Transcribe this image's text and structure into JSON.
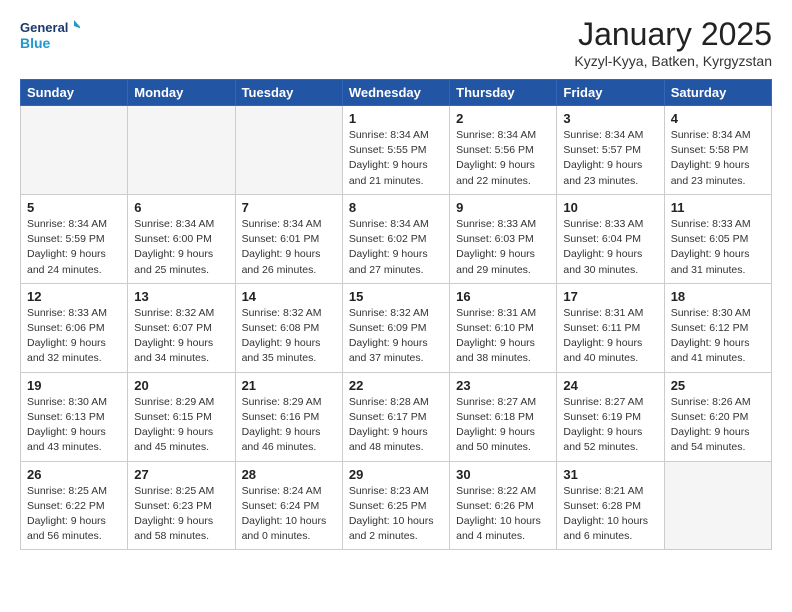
{
  "header": {
    "logo_line1": "General",
    "logo_line2": "Blue",
    "month_title": "January 2025",
    "location": "Kyzyl-Kyya, Batken, Kyrgyzstan"
  },
  "days_of_week": [
    "Sunday",
    "Monday",
    "Tuesday",
    "Wednesday",
    "Thursday",
    "Friday",
    "Saturday"
  ],
  "weeks": [
    [
      {
        "day": "",
        "empty": true
      },
      {
        "day": "",
        "empty": true
      },
      {
        "day": "",
        "empty": true
      },
      {
        "day": "1",
        "sunrise": "8:34 AM",
        "sunset": "5:55 PM",
        "daylight": "9 hours and 21 minutes."
      },
      {
        "day": "2",
        "sunrise": "8:34 AM",
        "sunset": "5:56 PM",
        "daylight": "9 hours and 22 minutes."
      },
      {
        "day": "3",
        "sunrise": "8:34 AM",
        "sunset": "5:57 PM",
        "daylight": "9 hours and 23 minutes."
      },
      {
        "day": "4",
        "sunrise": "8:34 AM",
        "sunset": "5:58 PM",
        "daylight": "9 hours and 23 minutes."
      }
    ],
    [
      {
        "day": "5",
        "sunrise": "8:34 AM",
        "sunset": "5:59 PM",
        "daylight": "9 hours and 24 minutes."
      },
      {
        "day": "6",
        "sunrise": "8:34 AM",
        "sunset": "6:00 PM",
        "daylight": "9 hours and 25 minutes."
      },
      {
        "day": "7",
        "sunrise": "8:34 AM",
        "sunset": "6:01 PM",
        "daylight": "9 hours and 26 minutes."
      },
      {
        "day": "8",
        "sunrise": "8:34 AM",
        "sunset": "6:02 PM",
        "daylight": "9 hours and 27 minutes."
      },
      {
        "day": "9",
        "sunrise": "8:33 AM",
        "sunset": "6:03 PM",
        "daylight": "9 hours and 29 minutes."
      },
      {
        "day": "10",
        "sunrise": "8:33 AM",
        "sunset": "6:04 PM",
        "daylight": "9 hours and 30 minutes."
      },
      {
        "day": "11",
        "sunrise": "8:33 AM",
        "sunset": "6:05 PM",
        "daylight": "9 hours and 31 minutes."
      }
    ],
    [
      {
        "day": "12",
        "sunrise": "8:33 AM",
        "sunset": "6:06 PM",
        "daylight": "9 hours and 32 minutes."
      },
      {
        "day": "13",
        "sunrise": "8:32 AM",
        "sunset": "6:07 PM",
        "daylight": "9 hours and 34 minutes."
      },
      {
        "day": "14",
        "sunrise": "8:32 AM",
        "sunset": "6:08 PM",
        "daylight": "9 hours and 35 minutes."
      },
      {
        "day": "15",
        "sunrise": "8:32 AM",
        "sunset": "6:09 PM",
        "daylight": "9 hours and 37 minutes."
      },
      {
        "day": "16",
        "sunrise": "8:31 AM",
        "sunset": "6:10 PM",
        "daylight": "9 hours and 38 minutes."
      },
      {
        "day": "17",
        "sunrise": "8:31 AM",
        "sunset": "6:11 PM",
        "daylight": "9 hours and 40 minutes."
      },
      {
        "day": "18",
        "sunrise": "8:30 AM",
        "sunset": "6:12 PM",
        "daylight": "9 hours and 41 minutes."
      }
    ],
    [
      {
        "day": "19",
        "sunrise": "8:30 AM",
        "sunset": "6:13 PM",
        "daylight": "9 hours and 43 minutes."
      },
      {
        "day": "20",
        "sunrise": "8:29 AM",
        "sunset": "6:15 PM",
        "daylight": "9 hours and 45 minutes."
      },
      {
        "day": "21",
        "sunrise": "8:29 AM",
        "sunset": "6:16 PM",
        "daylight": "9 hours and 46 minutes."
      },
      {
        "day": "22",
        "sunrise": "8:28 AM",
        "sunset": "6:17 PM",
        "daylight": "9 hours and 48 minutes."
      },
      {
        "day": "23",
        "sunrise": "8:27 AM",
        "sunset": "6:18 PM",
        "daylight": "9 hours and 50 minutes."
      },
      {
        "day": "24",
        "sunrise": "8:27 AM",
        "sunset": "6:19 PM",
        "daylight": "9 hours and 52 minutes."
      },
      {
        "day": "25",
        "sunrise": "8:26 AM",
        "sunset": "6:20 PM",
        "daylight": "9 hours and 54 minutes."
      }
    ],
    [
      {
        "day": "26",
        "sunrise": "8:25 AM",
        "sunset": "6:22 PM",
        "daylight": "9 hours and 56 minutes."
      },
      {
        "day": "27",
        "sunrise": "8:25 AM",
        "sunset": "6:23 PM",
        "daylight": "9 hours and 58 minutes."
      },
      {
        "day": "28",
        "sunrise": "8:24 AM",
        "sunset": "6:24 PM",
        "daylight": "10 hours and 0 minutes."
      },
      {
        "day": "29",
        "sunrise": "8:23 AM",
        "sunset": "6:25 PM",
        "daylight": "10 hours and 2 minutes."
      },
      {
        "day": "30",
        "sunrise": "8:22 AM",
        "sunset": "6:26 PM",
        "daylight": "10 hours and 4 minutes."
      },
      {
        "day": "31",
        "sunrise": "8:21 AM",
        "sunset": "6:28 PM",
        "daylight": "10 hours and 6 minutes."
      },
      {
        "day": "",
        "empty": true
      }
    ]
  ]
}
